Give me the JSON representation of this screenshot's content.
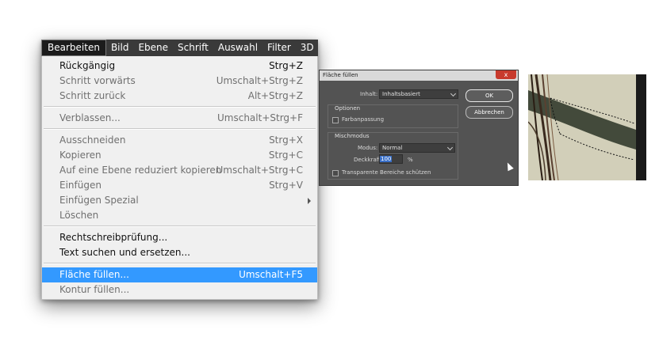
{
  "menubar": {
    "items": [
      "Bearbeiten",
      "Bild",
      "Ebene",
      "Schrift",
      "Auswahl",
      "Filter",
      "3D"
    ],
    "active": "Bearbeiten"
  },
  "edit_menu": {
    "items": [
      {
        "label": "Rückgängig",
        "shortcut": "Strg+Z",
        "enabled": true
      },
      {
        "label": "Schritt vorwärts",
        "shortcut": "Umschalt+Strg+Z",
        "enabled": false
      },
      {
        "label": "Schritt zurück",
        "shortcut": "Alt+Strg+Z",
        "enabled": false
      },
      {
        "label": "Verblassen...",
        "shortcut": "Umschalt+Strg+F",
        "enabled": false
      },
      {
        "label": "Ausschneiden",
        "shortcut": "Strg+X",
        "enabled": false
      },
      {
        "label": "Kopieren",
        "shortcut": "Strg+C",
        "enabled": false
      },
      {
        "label": "Auf eine Ebene reduziert kopieren",
        "shortcut": "Umschalt+Strg+C",
        "enabled": false
      },
      {
        "label": "Einfügen",
        "shortcut": "Strg+V",
        "enabled": false
      },
      {
        "label": "Einfügen Spezial",
        "shortcut": "",
        "enabled": false,
        "submenu": true
      },
      {
        "label": "Löschen",
        "shortcut": "",
        "enabled": false
      },
      {
        "label": "Rechtschreibprüfung...",
        "shortcut": "",
        "enabled": true
      },
      {
        "label": "Text suchen und ersetzen...",
        "shortcut": "",
        "enabled": true
      },
      {
        "label": "Fläche füllen...",
        "shortcut": "Umschalt+F5",
        "enabled": true,
        "highlighted": true
      },
      {
        "label": "Kontur füllen...",
        "shortcut": "",
        "enabled": false
      }
    ]
  },
  "fill_dialog": {
    "title": "Fläche füllen",
    "close_label": "x",
    "content_label": "Inhalt:",
    "content_value": "Inhaltsbasiert",
    "options_title": "Optionen",
    "color_adapt_label": "Farbanpassung",
    "blend_title": "Mischmodus",
    "mode_label": "Modus:",
    "mode_value": "Normal",
    "opacity_label": "Deckkraft:",
    "opacity_value": "100",
    "opacity_unit": "%",
    "transparent_label": "Transparente Bereiche schützen",
    "ok_label": "OK",
    "cancel_label": "Abbrechen"
  },
  "colors": {
    "menubar_bg": "#3a3a3a",
    "menu_bg": "#f0f0f0",
    "highlight": "#3399ff",
    "dialog_bg": "#535353"
  }
}
